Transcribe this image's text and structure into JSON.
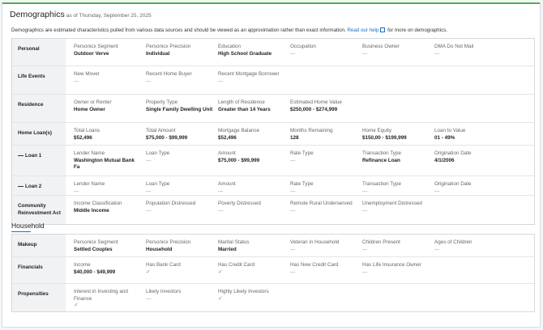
{
  "header": {
    "title": "Demographics",
    "subtitle": "as of Thursday, September 25, 2025"
  },
  "intro": {
    "text_before": "Demographics are estimated characteristics pulled from various data sources and should be viewed as an approximation rather than exact information.",
    "link_text": "Read our help",
    "text_after": "for more on demographics."
  },
  "demographics": [
    {
      "label": "Personal",
      "sub": false,
      "height": 33,
      "cells": [
        {
          "k": "Personicx Segment",
          "v": "Outdoor Verve"
        },
        {
          "k": "Personicx Precision",
          "v": "Individual"
        },
        {
          "k": "Education",
          "v": "High School Graduate"
        },
        {
          "k": "Occupation",
          "e": "—"
        },
        {
          "k": "Business Owner",
          "e": "—"
        },
        {
          "k": "DMA Do Not Mail",
          "e": "—"
        }
      ]
    },
    {
      "label": "Life Events",
      "sub": false,
      "height": 35,
      "cells": [
        {
          "k": "New Mover",
          "e": "—"
        },
        {
          "k": "Recent Home Buyer",
          "e": "—"
        },
        {
          "k": "Recent Mortgage Borrower",
          "e": "—"
        }
      ]
    },
    {
      "label": "Residence",
      "sub": false,
      "height": 35,
      "cells": [
        {
          "k": "Owner or Renter",
          "v": "Home Owner"
        },
        {
          "k": "Property Type",
          "v": "Single Family Dwelling Unit"
        },
        {
          "k": "Length of Residence",
          "v": "Greater than 14 Years"
        },
        {
          "k": "Estimated Home Value",
          "v": "$250,000 - $274,999"
        }
      ]
    },
    {
      "label": "Home Loan(s)",
      "sub": false,
      "height": 28,
      "cells": [
        {
          "k": "Total Loans",
          "v": "$52,496"
        },
        {
          "k": "Total Amount",
          "v": "$75,000 - $99,999"
        },
        {
          "k": "Mortgage Balance",
          "v": "$52,496"
        },
        {
          "k": "Months Remaining",
          "v": "128"
        },
        {
          "k": "Home Equity",
          "v": "$150,00 - $199,999"
        },
        {
          "k": "Loan to Value",
          "v": "01 - 49%"
        }
      ]
    },
    {
      "label": "Loan 1",
      "sub": true,
      "height": 38,
      "cells": [
        {
          "k": "Lender Name",
          "v": "Washington Mutual Bank Fa"
        },
        {
          "k": "Loan Type",
          "e": "—"
        },
        {
          "k": "Amount",
          "v": "$75,000 - $99,999"
        },
        {
          "k": "Rate Type",
          "e": "—"
        },
        {
          "k": "Transaction Type",
          "v": "Refinance Loan"
        },
        {
          "k": "Origination Date",
          "v": "4/1/2006"
        }
      ]
    },
    {
      "label": "Loan 2",
      "sub": true,
      "height": 24,
      "cells": [
        {
          "k": "Lender Name",
          "e": "—"
        },
        {
          "k": "Loan Type",
          "e": "—"
        },
        {
          "k": "Amount",
          "e": "—"
        },
        {
          "k": "Rate Type",
          "e": "—"
        },
        {
          "k": "Transaction Type",
          "e": "—"
        },
        {
          "k": "Origination Date",
          "e": "—"
        }
      ]
    },
    {
      "label": "Community Reinvestment Act",
      "sub": false,
      "height": 36,
      "cells": [
        {
          "k": "Income Classification",
          "v": "Middle Income"
        },
        {
          "k": "Population Distressed",
          "e": "—"
        },
        {
          "k": "Poverty Distressed",
          "e": "—"
        },
        {
          "k": "Remote Rural Underserved",
          "e": "—"
        },
        {
          "k": "Unemployment Distressed",
          "e": "—"
        }
      ]
    }
  ],
  "household_title": "Household",
  "household": [
    {
      "label": "Makeup",
      "sub": false,
      "height": 27,
      "cells": [
        {
          "k": "Personicx Segment",
          "v": "Settled Couples"
        },
        {
          "k": "Personicx Precision",
          "v": "Household"
        },
        {
          "k": "Marital Status",
          "v": "Married"
        },
        {
          "k": "Veteran in Household",
          "e": "—"
        },
        {
          "k": "Children Present",
          "e": "—"
        },
        {
          "k": "Ages of Children",
          "e": "—"
        }
      ]
    },
    {
      "label": "Financials",
      "sub": false,
      "height": 33,
      "cells": [
        {
          "k": "Income",
          "v": "$40,000 - $49,999"
        },
        {
          "k": "Has Bank Card",
          "c": "✓"
        },
        {
          "k": "Has Credit Card",
          "c": "✓"
        },
        {
          "k": "Has New Credit Card",
          "e": "—"
        },
        {
          "k": "Has Life Insurance Owner",
          "e": "—"
        }
      ]
    },
    {
      "label": "Propensities",
      "sub": false,
      "height": 35,
      "cells": [
        {
          "k": "Interest in Investing and Finance",
          "c": "✓"
        },
        {
          "k": "Likely Investors",
          "e": "—"
        },
        {
          "k": "Highly Likely Investors",
          "c": "✓"
        }
      ]
    }
  ]
}
